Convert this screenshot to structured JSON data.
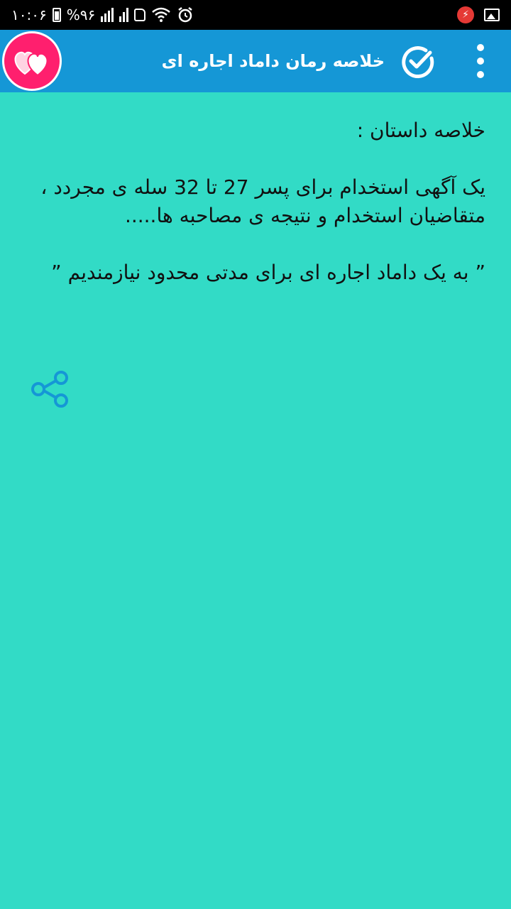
{
  "status_bar": {
    "time": "۱۰:۰۶",
    "battery_percent": "%۹۶"
  },
  "app_bar": {
    "title": "خلاصه رمان داماد اجاره ای"
  },
  "content": {
    "heading": "خلاصه داستان :",
    "paragraph_1": "یک آگهی استخدام برای پسر 27 تا 32 سله ی مجردد ، متقاضیان استخدام و نتیجه ی مصاحبه ها.....",
    "quote": "” به یک داماد اجاره ای برای مدتی محدود نیازمندیم ”"
  },
  "colors": {
    "background": "#32dbc6",
    "app_bar": "#1597d6",
    "hearts_button": "#ff1f6e",
    "share_icon": "#1597d6"
  },
  "icons": {
    "check": "check-circle-icon",
    "menu": "more-vert-icon",
    "hearts": "hearts-icon",
    "share": "share-icon"
  }
}
